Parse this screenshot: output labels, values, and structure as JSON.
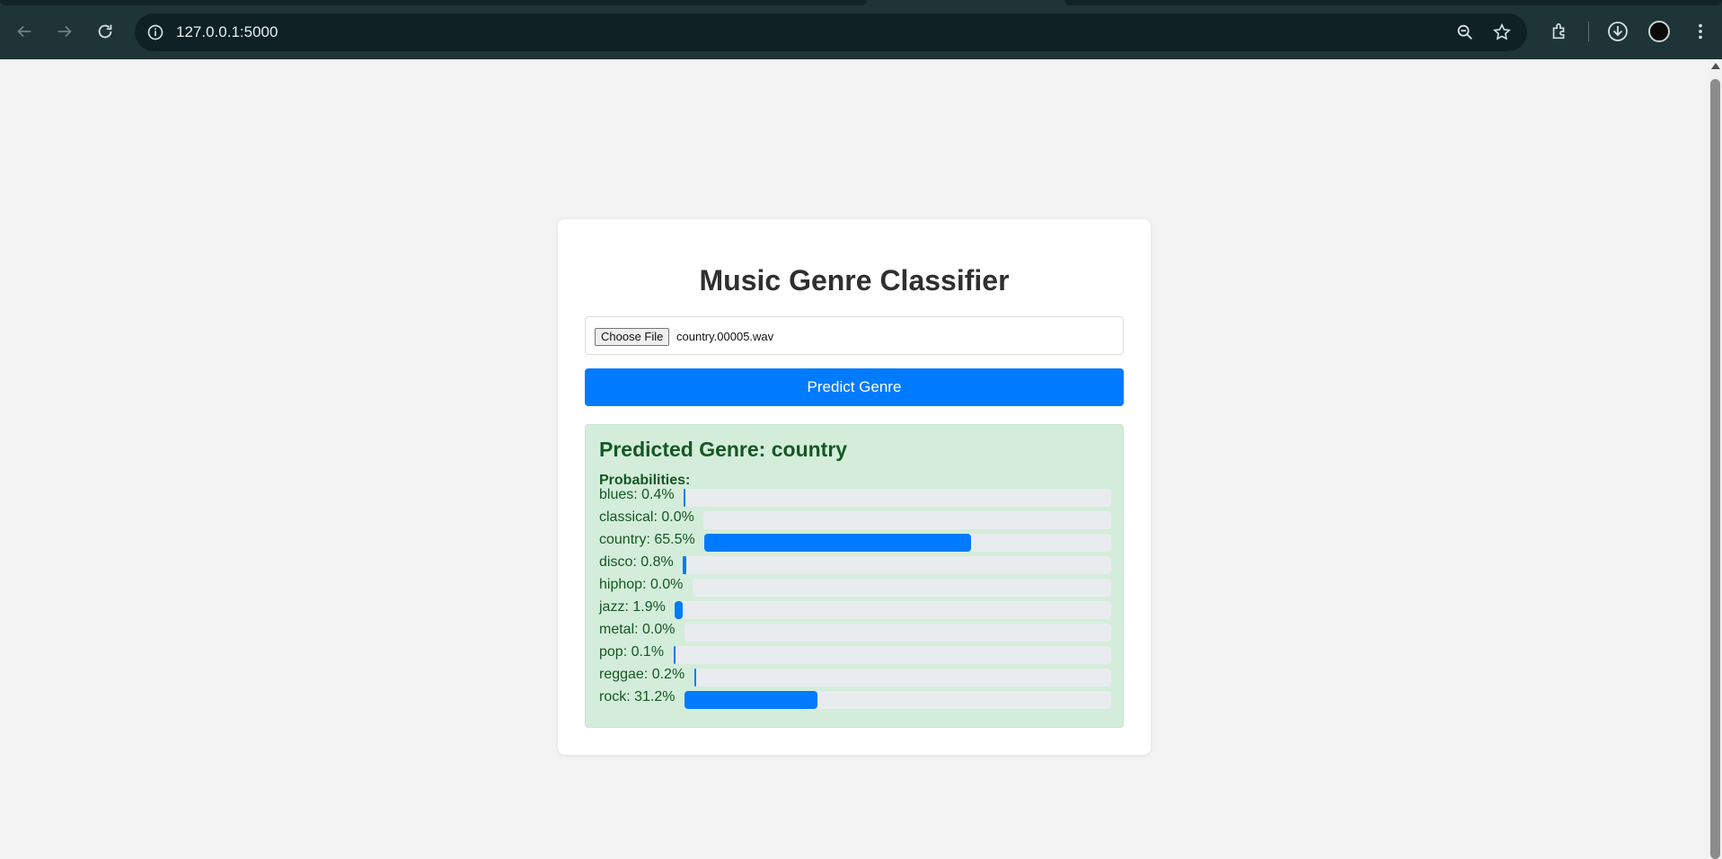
{
  "browser": {
    "url": "127.0.0.1:5000"
  },
  "page": {
    "title": "Music Genre Classifier",
    "file_input": {
      "button_label": "Choose File",
      "file_name": "country.00005.wav"
    },
    "predict_button_label": "Predict Genre",
    "result": {
      "heading": "Predicted Genre: country",
      "probabilities_label": "Probabilities:",
      "probabilities": [
        {
          "label": "blues: 0.4%",
          "genre": "blues",
          "percent": 0.4
        },
        {
          "label": "classical: 0.0%",
          "genre": "classical",
          "percent": 0.0
        },
        {
          "label": "country: 65.5%",
          "genre": "country",
          "percent": 65.5
        },
        {
          "label": "disco: 0.8%",
          "genre": "disco",
          "percent": 0.8
        },
        {
          "label": "hiphop: 0.0%",
          "genre": "hiphop",
          "percent": 0.0
        },
        {
          "label": "jazz: 1.9%",
          "genre": "jazz",
          "percent": 1.9
        },
        {
          "label": "metal: 0.0%",
          "genre": "metal",
          "percent": 0.0
        },
        {
          "label": "pop: 0.1%",
          "genre": "pop",
          "percent": 0.1
        },
        {
          "label": "reggae: 0.2%",
          "genre": "reggae",
          "percent": 0.2
        },
        {
          "label": "rock: 31.2%",
          "genre": "rock",
          "percent": 31.2
        }
      ]
    }
  },
  "colors": {
    "accent": "#007bff",
    "result_bg": "#d4edda",
    "result_text": "#155724",
    "track": "#e9ecef"
  }
}
